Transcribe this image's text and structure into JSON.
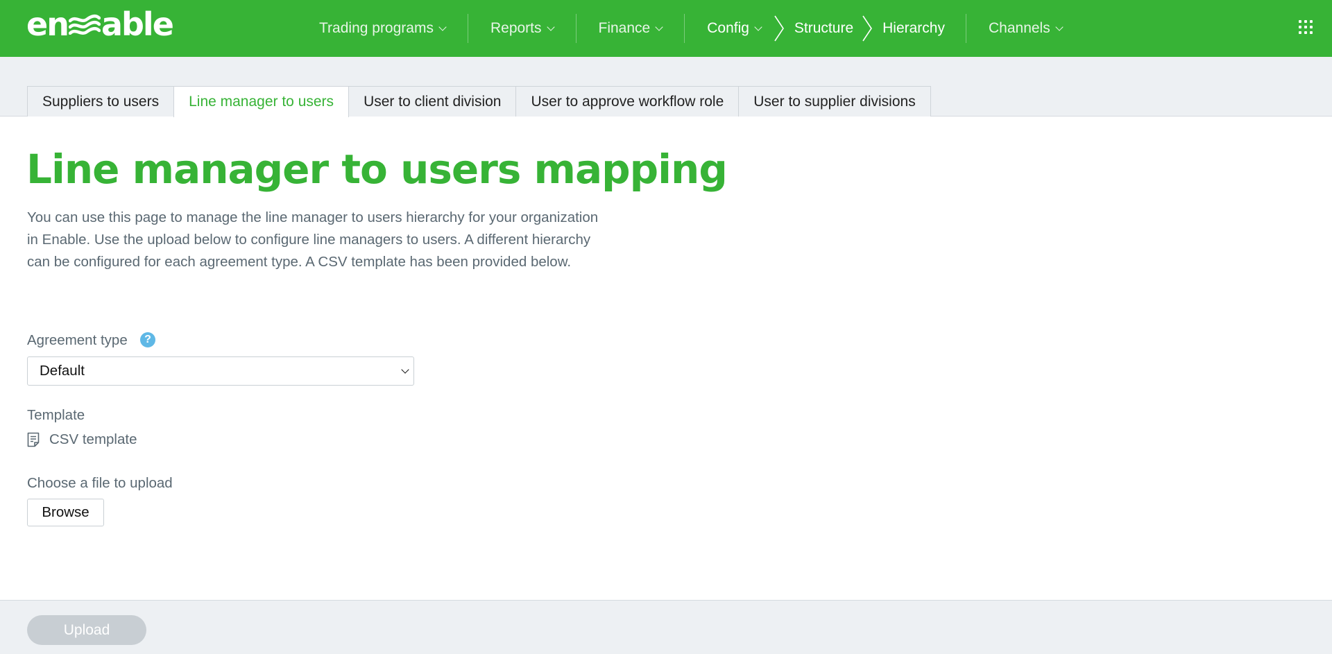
{
  "brand": {
    "logo_left": "en",
    "logo_right": "able",
    "primary_color": "#37b336",
    "accent_help": "#5fb8e6"
  },
  "nav": {
    "items": [
      {
        "label": "Trading programs"
      },
      {
        "label": "Reports"
      },
      {
        "label": "Finance"
      }
    ],
    "breadcrumb": [
      {
        "label": "Config"
      },
      {
        "label": "Structure"
      },
      {
        "label": "Hierarchy"
      }
    ],
    "channels": {
      "label": "Channels"
    },
    "apps_icon": "grid-icon"
  },
  "tabs": [
    {
      "label": "Suppliers to users",
      "active": false
    },
    {
      "label": "Line manager to users",
      "active": true
    },
    {
      "label": "User to client division",
      "active": false
    },
    {
      "label": "User to approve workflow role",
      "active": false
    },
    {
      "label": "User to supplier divisions",
      "active": false
    }
  ],
  "page": {
    "title": "Line manager to users mapping",
    "description": "You can use this page to manage the line manager to users hierarchy for your organization in Enable. Use the upload below to configure line managers to users. A different hierarchy can be configured for each agreement type. A CSV template has been provided below."
  },
  "form": {
    "agreement_type_label": "Agreement type",
    "help_glyph": "?",
    "agreement_type_value": "Default",
    "template_label": "Template",
    "template_link": "CSV template",
    "file_label": "Choose a file to upload",
    "browse_label": "Browse"
  },
  "footer": {
    "upload_label": "Upload",
    "upload_enabled": false
  }
}
